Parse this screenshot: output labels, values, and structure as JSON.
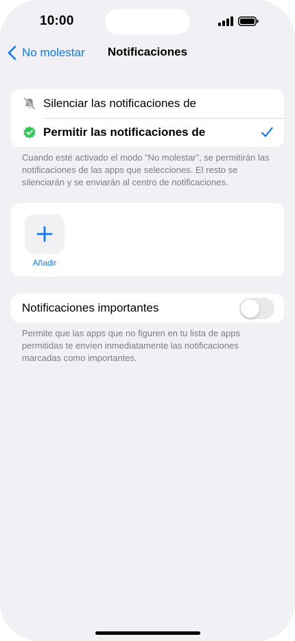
{
  "status_bar": {
    "time": "10:00",
    "icons": [
      "signal-icon",
      "battery-icon"
    ]
  },
  "nav": {
    "back_label": "No molestar",
    "title": "Notificaciones"
  },
  "mode_group": {
    "items": [
      {
        "label": "Silenciar las notificaciones de",
        "icon": "bell-slash-icon",
        "selected": false
      },
      {
        "label": "Permitir las notificaciones de",
        "icon": "verified-badge-icon",
        "selected": true
      }
    ],
    "footnote": "Cuando esté activado el modo “No molestar”, se permitirán las notificaciones de las apps que selecciones. El resto se silenciarán y se enviarán al centro de notificaciones."
  },
  "apps_group": {
    "add_label": "Añadir",
    "add_icon": "plus-icon"
  },
  "important_group": {
    "label": "Notificaciones importantes",
    "toggle_on": false,
    "footnote": "Permite que las apps que no figuren en tu lista de apps permitidas te envíen inmediatamente las notificaciones marcadas como importantes."
  },
  "colors": {
    "accent": "#0a7aff",
    "badge_green": "#34c759",
    "background": "#f0f0f5",
    "secondary_text": "#7b7b80"
  }
}
